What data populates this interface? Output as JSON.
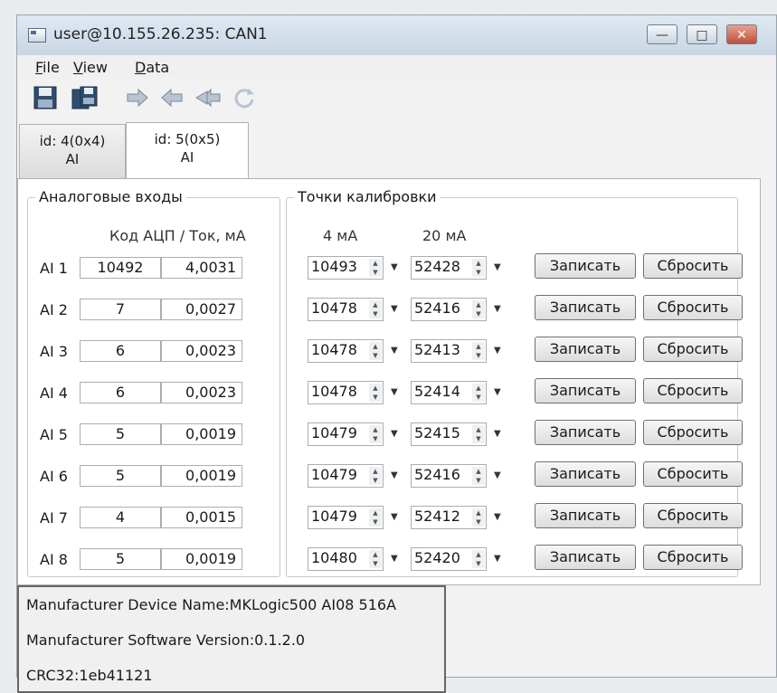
{
  "window": {
    "title": "user@10.155.26.235: CAN1",
    "controls": [
      "—",
      "□",
      "✕"
    ]
  },
  "menu": {
    "file_u": "F",
    "file_rest": "ile",
    "view_u": "V",
    "view_rest": "iew",
    "data_u": "D",
    "data_rest": "ata"
  },
  "toolbar": {
    "icons": [
      "save-icon",
      "save-all-icon",
      "arrow-right-icon",
      "arrow-left-icon",
      "arrow-left-double-icon",
      "refresh-icon"
    ]
  },
  "tabs": [
    {
      "line1": "id: 4(0x4)",
      "line2": "AI"
    },
    {
      "line1": "id: 5(0x5)",
      "line2": "AI"
    }
  ],
  "analog": {
    "title": "Аналоговые входы",
    "header": "Код АЦП / Ток, мА"
  },
  "calib": {
    "title": "Точки калибровки",
    "h4": "4 мА",
    "h20": "20 мА"
  },
  "buttons": {
    "write": "Записать",
    "reset": "Сбросить"
  },
  "rows": [
    {
      "label": "AI 1",
      "code": "10492",
      "current": "4,0031",
      "p4": "10493",
      "p20": "52428"
    },
    {
      "label": "AI 2",
      "code": "7",
      "current": "0,0027",
      "p4": "10478",
      "p20": "52416"
    },
    {
      "label": "AI 3",
      "code": "6",
      "current": "0,0023",
      "p4": "10478",
      "p20": "52413"
    },
    {
      "label": "AI 4",
      "code": "6",
      "current": "0,0023",
      "p4": "10478",
      "p20": "52414"
    },
    {
      "label": "AI 5",
      "code": "5",
      "current": "0,0019",
      "p4": "10479",
      "p20": "52415"
    },
    {
      "label": "AI 6",
      "code": "5",
      "current": "0,0019",
      "p4": "10479",
      "p20": "52416"
    },
    {
      "label": "AI 7",
      "code": "4",
      "current": "0,0015",
      "p4": "10479",
      "p20": "52412"
    },
    {
      "label": "AI 8",
      "code": "5",
      "current": "0,0019",
      "p4": "10480",
      "p20": "52420"
    }
  ],
  "status": {
    "line1": "Manufacturer Device Name:MKLogic500 AI08 516A",
    "line2": "Manufacturer Software Version:0.1.2.0",
    "line3": "CRC32:1eb41121"
  }
}
